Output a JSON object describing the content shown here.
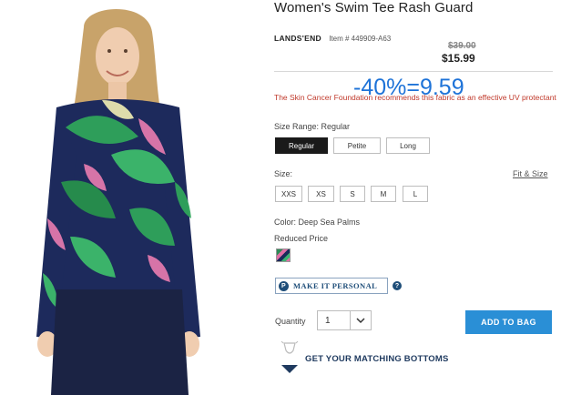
{
  "product": {
    "title": "Women's Swim Tee Rash Guard",
    "brand": "LANDS'END",
    "item_number": "Item # 449909-A63",
    "original_price": "$39.00",
    "sale_price": "$15.99",
    "discount_overlay": "-40%=9.59",
    "cancer_note": "The Skin Cancer Foundation recommends this fabric as an effective UV protectant"
  },
  "size_range": {
    "label": "Size Range: Regular",
    "options": [
      "Regular",
      "Petite",
      "Long"
    ],
    "selected": "Regular"
  },
  "size": {
    "label": "Size:",
    "fit_link": "Fit & Size",
    "options": [
      "XXS",
      "XS",
      "S",
      "M",
      "L"
    ]
  },
  "color": {
    "label": "Color: Deep Sea Palms",
    "reduced": "Reduced Price",
    "swatch_name": "Deep Sea Palms"
  },
  "personalize": {
    "icon": "P",
    "label": "MAKE IT PERSONAL",
    "help": "?"
  },
  "quantity": {
    "label": "Quantity",
    "value": "1"
  },
  "add_to_bag": "ADD TO BAG",
  "matching": "GET YOUR MATCHING BOTTOMS",
  "colors": {
    "accent": "#2a8fd6",
    "navy": "#1f3a5f",
    "warning_red": "#c0392b",
    "overlay_blue": "#1e73d8"
  }
}
